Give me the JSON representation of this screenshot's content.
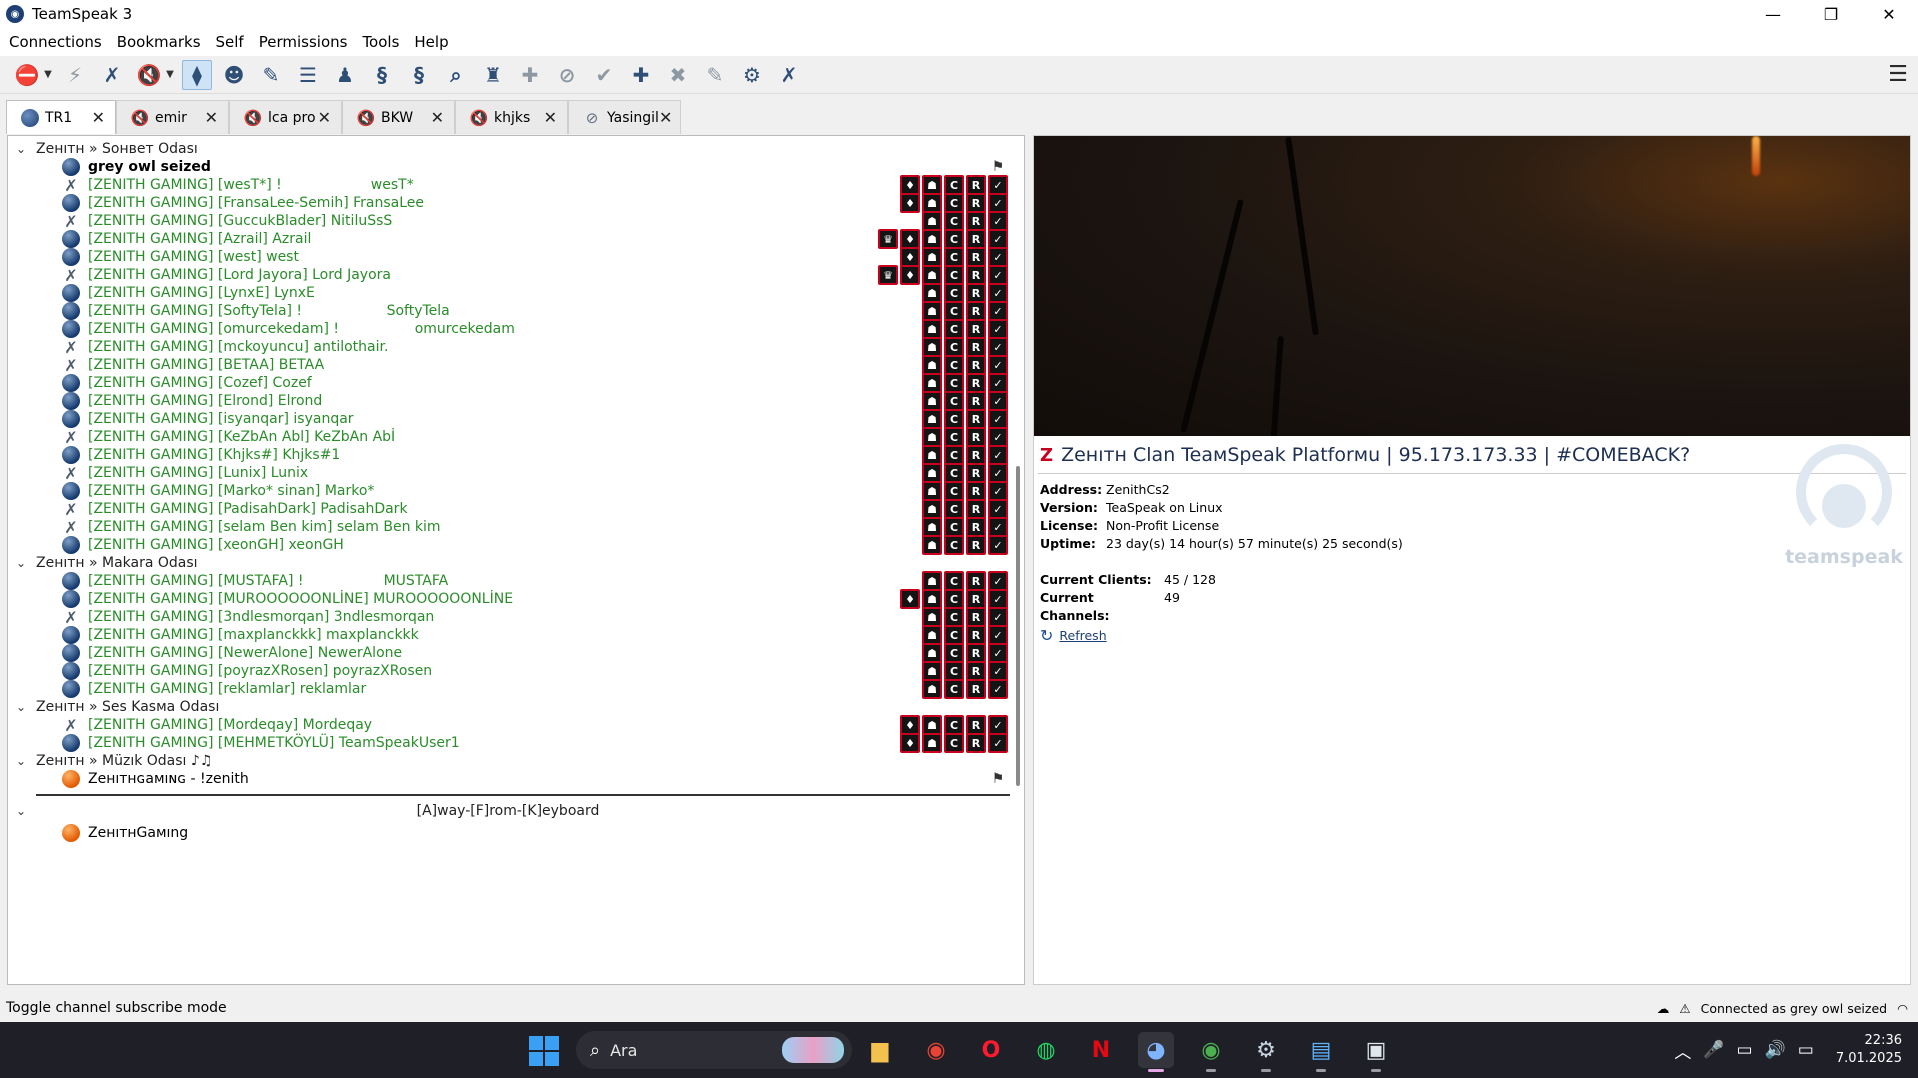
{
  "window": {
    "title": "TeamSpeak 3"
  },
  "menu": [
    "Connections",
    "Bookmarks",
    "Self",
    "Permissions",
    "Tools",
    "Help"
  ],
  "tabs": [
    {
      "label": "TR1",
      "icon": "connected-icon"
    },
    {
      "label": "emir",
      "icon": "muted-speaker-icon"
    },
    {
      "label": "lca pro",
      "icon": "muted-speaker-icon"
    },
    {
      "label": "BKW",
      "icon": "muted-speaker-icon"
    },
    {
      "label": "khjks",
      "icon": "muted-speaker-icon"
    },
    {
      "label": "Yasingil",
      "icon": "away-icon"
    }
  ],
  "channels": [
    {
      "name": "Zeнıтн » Sонвет Odası"
    },
    {
      "name": "Zeнıтн » Makara Odası"
    },
    {
      "name": "Zeнıтн » Ses Kasмa Odası"
    },
    {
      "name": "Zeнıтн » Müzık Odası ♪♫"
    },
    {
      "name": "[A]way-[F]rom-[K]eyboard"
    }
  ],
  "clients": [
    {
      "name": "grey owl seized",
      "type": "self"
    },
    {
      "name": "[ZENITH GAMING] [wesT*] !                    wesT*"
    },
    {
      "name": "[ZENITH GAMING] [FransaLee-Semih] FransaLee"
    },
    {
      "name": "[ZENITH GAMING] [GuccukBlader] NitiluSsS"
    },
    {
      "name": "[ZENITH GAMING] [Azrail] Azrail"
    },
    {
      "name": "[ZENITH GAMING] [west] west"
    },
    {
      "name": "[ZENITH GAMING] [Lord Jayora] Lord Jayora"
    },
    {
      "name": "[ZENITH GAMING] [LynxE] LynxE"
    },
    {
      "name": "[ZENITH GAMING] [SoftyTela] !                   SoftyTela"
    },
    {
      "name": "[ZENITH GAMING] [omurcekedam] !                 omurcekedam"
    },
    {
      "name": "[ZENITH GAMING] [mckoyuncu] antilothair."
    },
    {
      "name": "[ZENITH GAMING] [BETAA] BETAA"
    },
    {
      "name": "[ZENITH GAMING] [Cozef] Cozef"
    },
    {
      "name": "[ZENITH GAMING] [Elrond] Elrond"
    },
    {
      "name": "[ZENITH GAMING] [isyanqar] isyanqar"
    },
    {
      "name": "[ZENITH GAMING] [KeZbAn Abl] KeZbAn Abİ"
    },
    {
      "name": "[ZENITH GAMING] [Khjks#] Khjks#1"
    },
    {
      "name": "[ZENITH GAMING] [Lunix] Lunix"
    },
    {
      "name": "[ZENITH GAMING] [Marko* sinan] Marko*"
    },
    {
      "name": "[ZENITH GAMING] [PadisahDark] PadisahDark"
    },
    {
      "name": "[ZENITH GAMING] [selam Ben kim] selam Ben kim"
    },
    {
      "name": "[ZENITH GAMING] [xeonGH] xeonGH"
    },
    {
      "name": "[ZENITH GAMING] [MUSTAFA] !                  MUSTAFA"
    },
    {
      "name": "[ZENITH GAMING] [MUROOOOOONLİNE] MUROOOOOONLİNE"
    },
    {
      "name": "[ZENITH GAMING] [3ndlesmorqan] 3ndlesmorqan"
    },
    {
      "name": "[ZENITH GAMING] [maxplanckkk] maxplanckkk"
    },
    {
      "name": "[ZENITH GAMING] [NewerAlone] NewerAlone"
    },
    {
      "name": "[ZENITH GAMING] [poyrazXRosen] poyrazXRosen"
    },
    {
      "name": "[ZENITH GAMING] [reklamlar] reklamlar"
    },
    {
      "name": "[ZENITH GAMING] [Mordeqay] Mordeqay"
    },
    {
      "name": "[ZENITH GAMING] [MEHMETKÖYLÜ] TeamSpeakUser1"
    },
    {
      "name": "Zeнıтнɢaмıɴɢ - !zenith",
      "type": "bot"
    },
    {
      "name": "ZeнıтнGaмıng",
      "type": "bot"
    }
  ],
  "server": {
    "title": "Zeнıтн Clan TeaмSpeak Platforмu | 95.173.173.33 | #COMEBACK?",
    "address_label": "Address:",
    "address": "ZenithCs2",
    "version_label": "Version:",
    "version": "TeaSpeak on Linux",
    "license_label": "License:",
    "license": "Non-Profit License",
    "uptime_label": "Uptime:",
    "uptime": "23 day(s) 14 hour(s) 57 minute(s) 25 second(s)",
    "clients_label": "Current Clients:",
    "clients": "45 / 128",
    "channels_label": "Current Channels:",
    "channels": "49",
    "refresh": "Refresh",
    "logo_text": "teamspeak"
  },
  "status": {
    "left": "Toggle channel subscribe mode",
    "right": "Connected as grey owl seized"
  },
  "taskbar": {
    "search_placeholder": "Ara",
    "time": "22:36",
    "date": "7.01.2025"
  },
  "colors": {
    "accent": "#1d3f73",
    "client_green": "#2a8c2a",
    "badge_border": "#c8001e"
  }
}
